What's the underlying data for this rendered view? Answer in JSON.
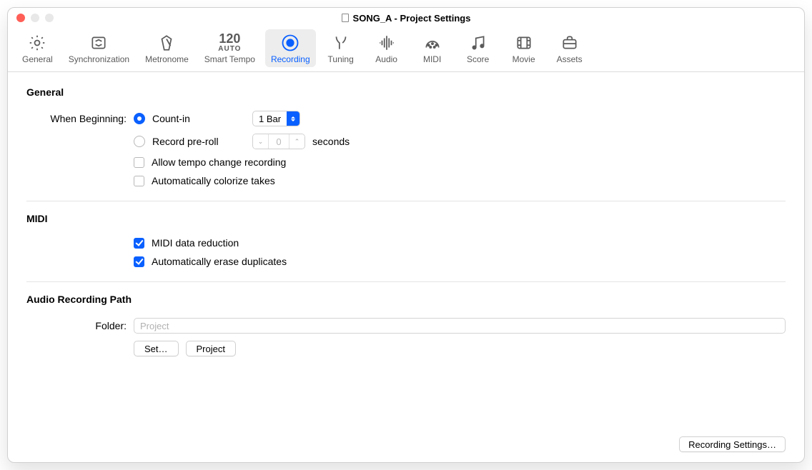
{
  "window_title": "SONG_A - Project Settings",
  "tabs": {
    "general": "General",
    "sync": "Synchronization",
    "metronome": "Metronome",
    "smart_tempo": "Smart Tempo",
    "smart_tempo_num": "120",
    "smart_tempo_auto": "AUTO",
    "recording": "Recording",
    "tuning": "Tuning",
    "audio": "Audio",
    "midi": "MIDI",
    "score": "Score",
    "movie": "Movie",
    "assets": "Assets"
  },
  "sections": {
    "general": {
      "title": "General",
      "when_beginning_label": "When Beginning:",
      "count_in_label": "Count-in",
      "count_in_value": "1 Bar",
      "preroll_label": "Record pre-roll",
      "preroll_value": "0",
      "seconds_label": "seconds",
      "allow_tempo_label": "Allow tempo change recording",
      "colorize_label": "Automatically colorize takes"
    },
    "midi": {
      "title": "MIDI",
      "reduction_label": "MIDI data reduction",
      "erase_dup_label": "Automatically erase duplicates"
    },
    "audio_path": {
      "title": "Audio Recording Path",
      "folder_label": "Folder:",
      "folder_value": "Project",
      "set_btn": "Set…",
      "project_btn": "Project"
    }
  },
  "footer_btn": "Recording Settings…"
}
